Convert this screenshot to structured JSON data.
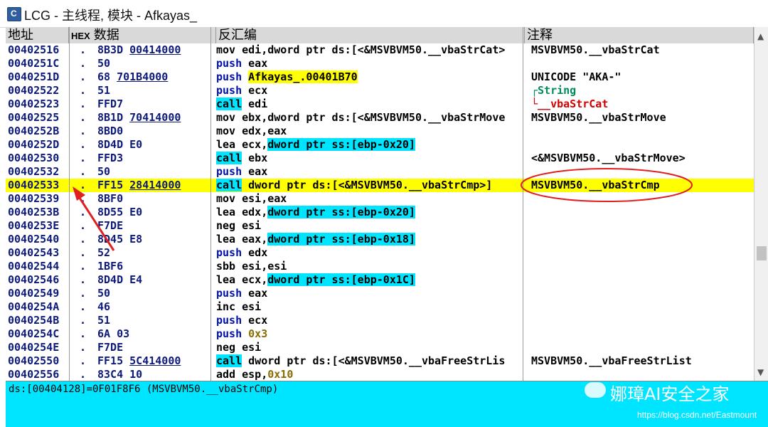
{
  "window": {
    "title": "LCG - 主线程, 模块 - Afkayas_"
  },
  "headers": {
    "address": "地址",
    "hex_tag": "HEX",
    "hex": "数据",
    "disasm": "反汇编",
    "comment": "注释"
  },
  "rows": [
    {
      "addr": "00402516",
      "dot": ".",
      "hex": [
        "8B3D ",
        "00414000"
      ],
      "asm": [
        [
          "mov edi,dword ptr ds:[<&MSVBVM50.__vbaStrCat>",
          ""
        ]
      ],
      "cmt": [
        [
          "MSVBVM50.__vbaStrCat",
          ""
        ]
      ]
    },
    {
      "addr": "0040251C",
      "dot": ".",
      "hex": [
        "50",
        ""
      ],
      "asm": [
        [
          "push",
          "kw-push"
        ],
        [
          " eax",
          ""
        ]
      ],
      "cmt": []
    },
    {
      "addr": "0040251D",
      "dot": ".",
      "hex": [
        "68 ",
        "701B4000"
      ],
      "asm": [
        [
          "push",
          "kw-push"
        ],
        [
          " ",
          ""
        ],
        [
          "Afkayas_.00401B70",
          "hl-yellow"
        ]
      ],
      "cmt": [
        [
          "UNICODE \"AKA-\"",
          ""
        ]
      ]
    },
    {
      "addr": "00402522",
      "dot": ".",
      "hex": [
        "51",
        ""
      ],
      "asm": [
        [
          "push",
          "kw-push"
        ],
        [
          " ecx",
          ""
        ]
      ],
      "cmt": [
        [
          "┌String",
          "cmt-green"
        ]
      ]
    },
    {
      "addr": "00402523",
      "dot": ".",
      "hex": [
        "FFD7",
        ""
      ],
      "asm": [
        [
          "call",
          "kw-call"
        ],
        [
          " edi",
          ""
        ]
      ],
      "cmt": [
        [
          "└__vbaStrCat",
          "cmt-red"
        ]
      ]
    },
    {
      "addr": "00402525",
      "dot": ".",
      "hex": [
        "8B1D ",
        "70414000"
      ],
      "asm": [
        [
          "mov ebx,dword ptr ds:[<&MSVBVM50.__vbaStrMove",
          ""
        ]
      ],
      "cmt": [
        [
          "MSVBVM50.__vbaStrMove",
          ""
        ]
      ]
    },
    {
      "addr": "0040252B",
      "dot": ".",
      "hex": [
        "8BD0",
        ""
      ],
      "asm": [
        [
          "mov edx,eax",
          ""
        ]
      ],
      "cmt": []
    },
    {
      "addr": "0040252D",
      "dot": ".",
      "hex": [
        "8D4D E0",
        ""
      ],
      "asm": [
        [
          "lea ecx,",
          ""
        ],
        [
          "dword ptr ss:[ebp-0x20]",
          "hl-cyan"
        ]
      ],
      "cmt": []
    },
    {
      "addr": "00402530",
      "dot": ".",
      "hex": [
        "FFD3",
        ""
      ],
      "asm": [
        [
          "call",
          "kw-call"
        ],
        [
          " ebx",
          ""
        ]
      ],
      "cmt": [
        [
          "<&MSVBVM50.__vbaStrMove>",
          ""
        ]
      ]
    },
    {
      "addr": "00402532",
      "dot": ".",
      "hex": [
        "50",
        ""
      ],
      "asm": [
        [
          "push",
          "kw-push"
        ],
        [
          " eax",
          ""
        ]
      ],
      "cmt": []
    },
    {
      "addr": "00402533",
      "dot": ".",
      "hex": [
        "FF15 ",
        "28414000"
      ],
      "asm": [
        [
          "call",
          "kw-call"
        ],
        [
          " dword ptr ds:[<&MSVBVM50.__vbaStrCmp>]",
          ""
        ]
      ],
      "cmt": [
        [
          "MSVBVM50.__vbaStrCmp",
          ""
        ]
      ],
      "selected": true
    },
    {
      "addr": "00402539",
      "dot": ".",
      "hex": [
        "8BF0",
        ""
      ],
      "asm": [
        [
          "mov esi,eax",
          ""
        ]
      ],
      "cmt": []
    },
    {
      "addr": "0040253B",
      "dot": ".",
      "hex": [
        "8D55 E0",
        ""
      ],
      "asm": [
        [
          "lea edx,",
          ""
        ],
        [
          "dword ptr ss:[ebp-0x20]",
          "hl-cyan"
        ]
      ],
      "cmt": []
    },
    {
      "addr": "0040253E",
      "dot": ".",
      "hex": [
        "F7DE",
        ""
      ],
      "asm": [
        [
          "neg esi",
          ""
        ]
      ],
      "cmt": []
    },
    {
      "addr": "00402540",
      "dot": ".",
      "hex": [
        "8D45 E8",
        ""
      ],
      "asm": [
        [
          "lea eax,",
          ""
        ],
        [
          "dword ptr ss:[ebp-0x18]",
          "hl-cyan"
        ]
      ],
      "cmt": []
    },
    {
      "addr": "00402543",
      "dot": ".",
      "hex": [
        "52",
        ""
      ],
      "asm": [
        [
          "push",
          "kw-push"
        ],
        [
          " edx",
          ""
        ]
      ],
      "cmt": []
    },
    {
      "addr": "00402544",
      "dot": ".",
      "hex": [
        "1BF6",
        ""
      ],
      "asm": [
        [
          "sbb esi,esi",
          ""
        ]
      ],
      "cmt": []
    },
    {
      "addr": "00402546",
      "dot": ".",
      "hex": [
        "8D4D E4",
        ""
      ],
      "asm": [
        [
          "lea ecx,",
          ""
        ],
        [
          "dword ptr ss:[ebp-0x1C]",
          "hl-cyan"
        ]
      ],
      "cmt": []
    },
    {
      "addr": "00402549",
      "dot": ".",
      "hex": [
        "50",
        ""
      ],
      "asm": [
        [
          "push",
          "kw-push"
        ],
        [
          " eax",
          ""
        ]
      ],
      "cmt": []
    },
    {
      "addr": "0040254A",
      "dot": ".",
      "hex": [
        "46",
        ""
      ],
      "asm": [
        [
          "inc esi",
          ""
        ]
      ],
      "cmt": []
    },
    {
      "addr": "0040254B",
      "dot": ".",
      "hex": [
        "51",
        ""
      ],
      "asm": [
        [
          "push",
          "kw-push"
        ],
        [
          " ecx",
          ""
        ]
      ],
      "cmt": []
    },
    {
      "addr": "0040254C",
      "dot": ".",
      "hex": [
        "6A 03",
        ""
      ],
      "asm": [
        [
          "push",
          "kw-push"
        ],
        [
          " ",
          ""
        ],
        [
          "0x3",
          "imm"
        ]
      ],
      "cmt": []
    },
    {
      "addr": "0040254E",
      "dot": ".",
      "hex": [
        "F7DE",
        ""
      ],
      "asm": [
        [
          "neg esi",
          ""
        ]
      ],
      "cmt": []
    },
    {
      "addr": "00402550",
      "dot": ".",
      "hex": [
        "FF15 ",
        "5C414000"
      ],
      "asm": [
        [
          "call",
          "kw-call"
        ],
        [
          " dword ptr ds:[<&MSVBVM50.__vbaFreeStrLis",
          ""
        ]
      ],
      "cmt": [
        [
          "MSVBVM50.__vbaFreeStrList",
          ""
        ]
      ]
    },
    {
      "addr": "00402556",
      "dot": ".",
      "hex": [
        "83C4 10",
        ""
      ],
      "asm": [
        [
          "add esp,",
          ""
        ],
        [
          "0x10",
          "imm"
        ]
      ],
      "cmt": []
    }
  ],
  "status": {
    "text": "ds:[00404128]=0F01F8F6 (MSVBVM50.__vbaStrCmp)"
  },
  "watermark": {
    "title": "娜璋AI安全之家",
    "url": "https://blog.csdn.net/Eastmount"
  },
  "colors": {
    "selected_row": "#ffff00",
    "highlight_cyan": "#00e5ff",
    "annotation_red": "#e02020"
  },
  "icons": {
    "app": "lcg-window-icon",
    "scroll_up": "scroll-up-arrow-icon",
    "scroll_down": "scroll-down-arrow-icon",
    "watermark": "wechat-icon"
  }
}
